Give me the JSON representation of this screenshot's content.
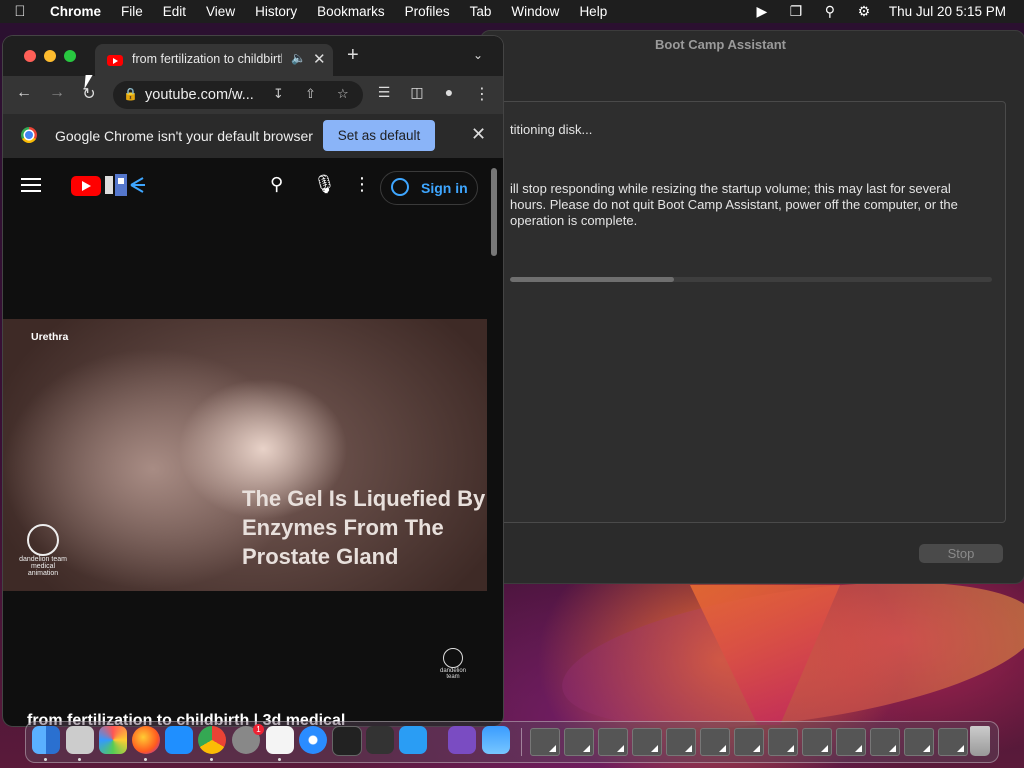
{
  "menubar": {
    "app_name": "Chrome",
    "items": [
      "File",
      "Edit",
      "View",
      "History",
      "Bookmarks",
      "Profiles",
      "Tab",
      "Window",
      "Help"
    ],
    "clock": "Thu Jul 20  5:15 PM"
  },
  "bootcamp": {
    "title": "Boot Camp Assistant",
    "status": "titioning disk...",
    "description": "ill stop responding while resizing the startup volume; this may last for several hours. Please do not quit Boot Camp Assistant, power off the computer, or the operation is complete.",
    "progress_fraction": 0.34,
    "stop_label": "Stop"
  },
  "chrome": {
    "tab_title": "from fertilization to childbirth",
    "url": "youtube.com/w...",
    "infobar_text": "Google Chrome isn't your default browser",
    "set_default_label": "Set as default"
  },
  "youtube": {
    "sign_in_label": "Sign in",
    "video_label": "Urethra",
    "caption": "The Gel Is Liquefied By Enzymes From The Prostate Gland",
    "watermark_text": "dandelion team",
    "watermark_sub": "medical animation",
    "video_title_partial": "from fertilization to childbirth | 3d medical"
  },
  "dock": {
    "apps": [
      "finder",
      "disk-utility",
      "launchpad",
      "firefox",
      "app-store",
      "chrome",
      "system-settings",
      "textedit",
      "safari",
      "terminal",
      "garageband",
      "vscode",
      "visual-studio",
      "weather"
    ],
    "settings_badge": "1"
  },
  "colors": {
    "accent_blue": "#8ab4f8",
    "youtube_red": "#ff0000",
    "signin_blue": "#3ea6ff"
  }
}
